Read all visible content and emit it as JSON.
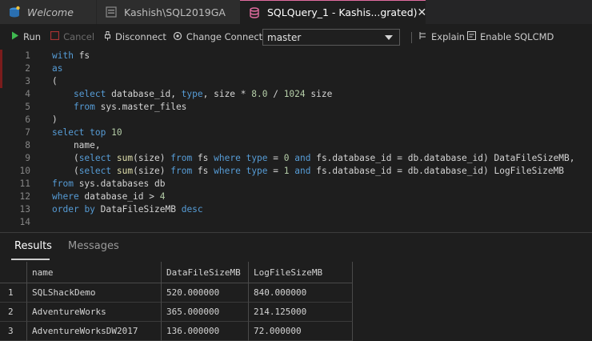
{
  "tabs": [
    {
      "label": "Welcome",
      "icon": "welcome-icon"
    },
    {
      "label": "Kashish\\SQL2019GA",
      "icon": "server-connection-icon"
    },
    {
      "label": "SQLQuery_1 - Kashis...grated)",
      "icon": "query-file-icon",
      "active": true
    }
  ],
  "toolbar": {
    "run_label": "Run",
    "cancel_label": "Cancel",
    "disconnect_label": "Disconnect",
    "change_connection_label": "Change Connection",
    "database_value": "master",
    "explain_label": "Explain",
    "sqlcmd_label": "Enable SQLCMD"
  },
  "editor": {
    "lines": [
      {
        "n": "1",
        "html": "<span class=\"kw\">with</span> fs"
      },
      {
        "n": "2",
        "html": "<span class=\"kw\">as</span>"
      },
      {
        "n": "3",
        "html": "("
      },
      {
        "n": "4",
        "html": "    <span class=\"kw\">select</span> database_id, <span class=\"kw\">type</span>, size * <span class=\"num\">8.0</span> / <span class=\"num\">1024</span> size"
      },
      {
        "n": "5",
        "html": "    <span class=\"kw\">from</span> sys.master_files"
      },
      {
        "n": "6",
        "html": ")"
      },
      {
        "n": "7",
        "html": "<span class=\"kw\">select</span> <span class=\"kw\">top</span> <span class=\"num\">10</span>"
      },
      {
        "n": "8",
        "html": "    name,"
      },
      {
        "n": "9",
        "html": "    (<span class=\"kw\">select</span> <span class=\"fn\">sum</span>(size) <span class=\"kw\">from</span> fs <span class=\"kw\">where</span> <span class=\"kw\">type</span> = <span class=\"num\">0</span> <span class=\"kw\">and</span> fs.database_id = db.database_id) DataFileSizeMB,"
      },
      {
        "n": "10",
        "html": "    (<span class=\"kw\">select</span> <span class=\"fn\">sum</span>(size) <span class=\"kw\">from</span> fs <span class=\"kw\">where</span> <span class=\"kw\">type</span> = <span class=\"num\">1</span> <span class=\"kw\">and</span> fs.database_id = db.database_id) LogFileSizeMB"
      },
      {
        "n": "11",
        "html": "<span class=\"kw\">from</span> sys.databases db"
      },
      {
        "n": "12",
        "html": "<span class=\"kw\">where</span> database_id > <span class=\"num\">4</span>"
      },
      {
        "n": "13",
        "html": "<span class=\"kw\">order</span> <span class=\"kw\">by</span> DataFileSizeMB <span class=\"kw\">desc</span>"
      },
      {
        "n": "14",
        "html": ""
      }
    ]
  },
  "results": {
    "tabs": {
      "results_label": "Results",
      "messages_label": "Messages"
    },
    "columns": [
      "name",
      "DataFileSizeMB",
      "LogFileSizeMB"
    ],
    "rows": [
      {
        "num": "1",
        "cells": [
          "SQLShackDemo",
          "520.000000",
          "840.000000"
        ]
      },
      {
        "num": "2",
        "cells": [
          "AdventureWorks",
          "365.000000",
          "214.125000"
        ]
      },
      {
        "num": "3",
        "cells": [
          "AdventureWorksDW2017",
          "136.000000",
          "72.000000"
        ]
      }
    ]
  },
  "colors": {
    "accent": "#e06c9f",
    "keyword": "#569cd6",
    "number": "#b5cea8",
    "function": "#dcdcaa",
    "run": "#3fb950"
  }
}
